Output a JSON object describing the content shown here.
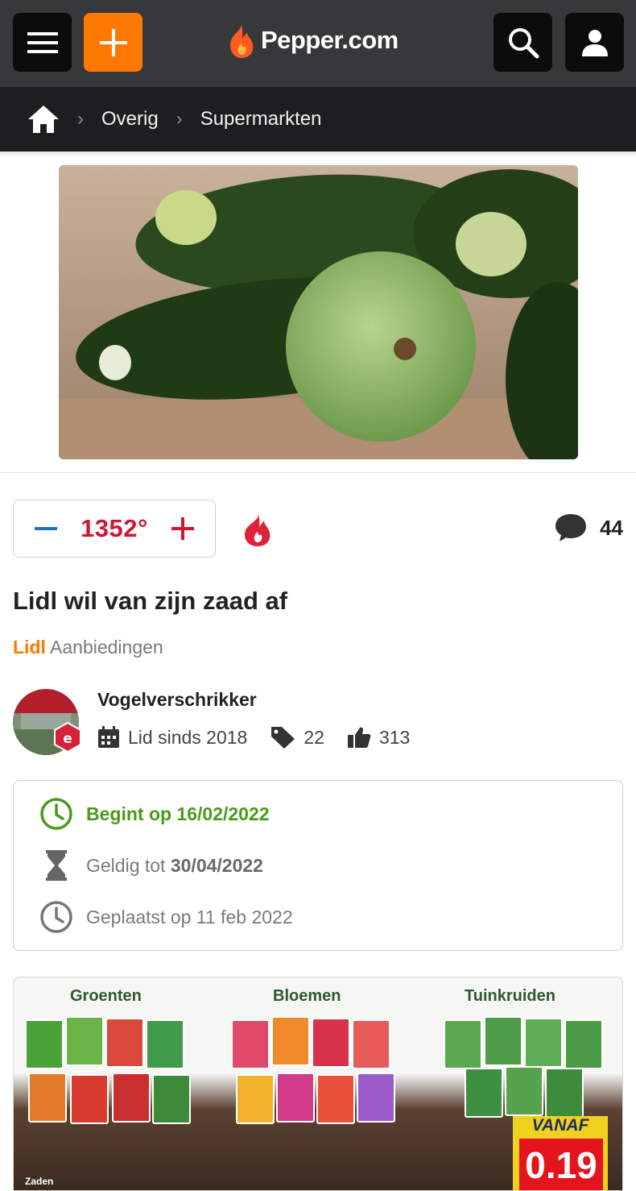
{
  "header": {
    "logo_text": "Pepper.com",
    "icons": [
      "menu-icon",
      "plus-icon",
      "flame-logo-icon",
      "search-icon",
      "user-icon"
    ]
  },
  "breadcrumb": {
    "items": [
      "Overig",
      "Supermarkten"
    ]
  },
  "deal": {
    "temperature": "1352°",
    "comment_count": "44",
    "title": "Lidl wil van zijn zaad af",
    "merchant": "Lidl",
    "category": "Aanbiedingen"
  },
  "user": {
    "name": "Vogelverschrikker",
    "member_since": "Lid sinds 2018",
    "deals": "22",
    "likes": "313"
  },
  "info": {
    "starts": "Begint op 16/02/2022",
    "valid_prefix": "Geldig tot",
    "valid_date": "30/04/2022",
    "posted": "Geplaatst op 11 feb 2022"
  },
  "promo": {
    "headers": [
      "Groenten",
      "Bloemen",
      "Tuinkruiden"
    ],
    "vanaf": "VANAF",
    "price": "0.19",
    "footer": "Zaden"
  },
  "colors": {
    "accent": "#ff7900",
    "temperature": "#ce1734",
    "start_green": "#4a9b1b",
    "topbar": "#37383a",
    "breadcrumb_bar": "#1d1e20"
  }
}
